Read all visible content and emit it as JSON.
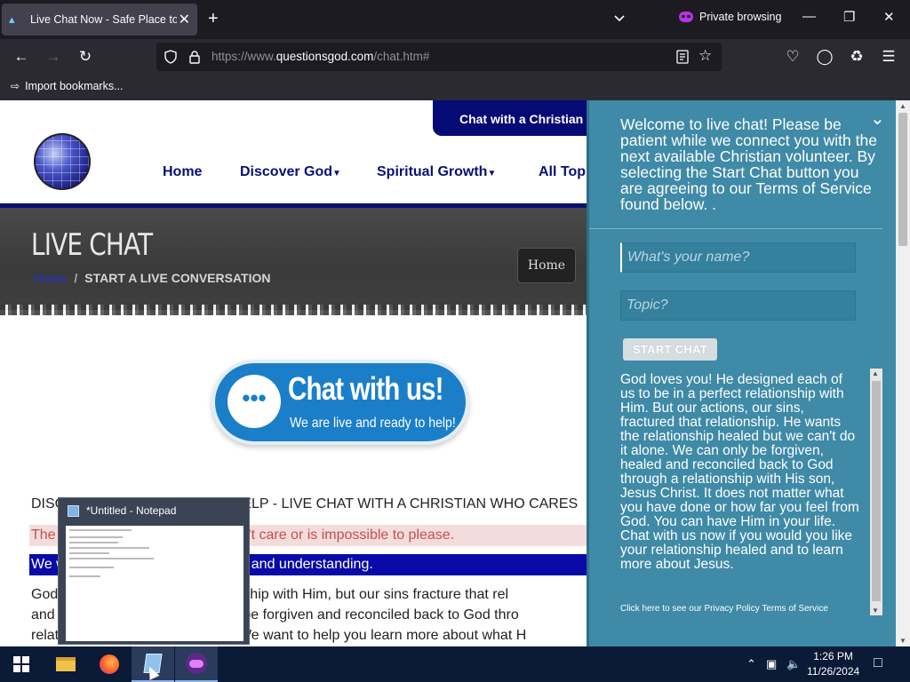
{
  "browser": {
    "tab_title": "Live Chat Now - Safe Place to t",
    "new_tab": "+",
    "private_label": "Private browsing",
    "url_prefix": "https://www.",
    "url_domain": "questionsgod.com",
    "url_path": "/chat.htm#",
    "bookmark_label": "Import bookmarks..."
  },
  "site": {
    "cta": "Chat with a Christian",
    "nav": [
      "Home",
      "Discover God",
      "Spiritual Growth",
      "All Top"
    ],
    "hero_title": "LIVE CHAT",
    "breadcrumb_home": "Home",
    "breadcrumb_sep": "/",
    "breadcrumb_current": "START A LIVE CONVERSATION",
    "home_button": "Home",
    "bubble_title": "Chat with us!",
    "bubble_sub": "We are live and ready to help!",
    "discover_line": "DISCOVER HOW JESUS CAN HELP - LIVE CHAT WITH A CHRISTIAN WHO CARES",
    "red_line": "The                                       doesn't care or is impossible to please.",
    "blue_line": "We w                                    peace and understanding.",
    "para1": "God                                   relationship with Him, but our sins fracture that rel",
    "para2": "and                                   an only be forgiven and reconciled back to God thro",
    "para3": "relat                                  Christ. We want to help you learn more about what H"
  },
  "notepad_preview": {
    "title": "*Untitled - Notepad"
  },
  "chat": {
    "welcome": "Welcome to live chat! Please be patient while we connect you with the next available Christian volunteer. By selecting the Start Chat button you are agreeing to our Terms of Service found below. .",
    "name_placeholder": "What's your name?",
    "topic_placeholder": "Topic?",
    "start_label": "START CHAT",
    "message": "God loves you! He designed each of us to be in a perfect relationship with Him. But our actions, our sins, fractured that relationship. He wants the relationship healed but we can't do it alone. We can only be forgiven, healed and reconciled back to God through a relationship with His son, Jesus Christ. It does not matter what you have done or how far you feel from God. You can have Him in your life. Chat with us now if you would you like your relationship healed and to learn more about Jesus.",
    "links": "Click here to see our Privacy Policy Terms of Service"
  },
  "taskbar": {
    "time": "1:26 PM",
    "date": "11/26/2024"
  },
  "colors": {
    "brand_navy": "#0a1075",
    "chat_panel": "#3f8aa6",
    "browser_dark": "#1c1b22"
  }
}
